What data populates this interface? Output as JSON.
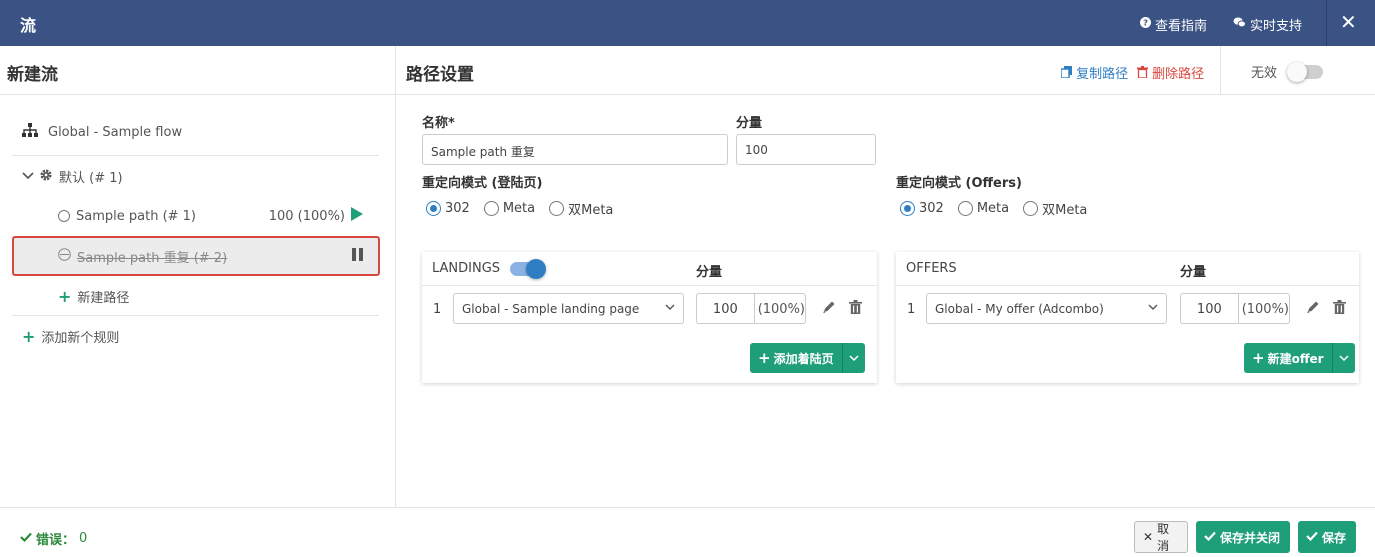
{
  "header": {
    "title": "流",
    "guide_label": "查看指南",
    "support_label": "实时支持",
    "close_label": "✕"
  },
  "left": {
    "title": "新建流",
    "flow_name": "Global - Sample flow",
    "rule_name": "默认 (# 1)",
    "paths": [
      {
        "label": "Sample path (# 1)",
        "share": "100 (100%)",
        "status": "active"
      },
      {
        "label": "Sample path 重复 (# 2)",
        "status": "paused"
      }
    ],
    "new_path_label": "新建路径",
    "add_rule_label": "添加新个规则"
  },
  "path_settings": {
    "title": "路径设置",
    "copy_label": "复制路径",
    "delete_label": "删除路径",
    "invalid_label": "无效",
    "name_label": "名称*",
    "name_value": "Sample path 重复",
    "share_label": "分量",
    "share_value": "100",
    "redirect_landing_label": "重定向模式 (登陆页)",
    "redirect_offers_label": "重定向模式 (Offers)",
    "redirect_options": [
      "302",
      "Meta",
      "双Meta"
    ],
    "landing_selected": "302",
    "offers_selected": "302"
  },
  "landings": {
    "title": "LANDINGS",
    "share_header": "分量",
    "rows": [
      {
        "index": "1",
        "name": "Global - Sample landing page",
        "share": "100",
        "percent": "(100%)"
      }
    ],
    "add_label": "添加着陆页"
  },
  "offers": {
    "title": "OFFERS",
    "share_header": "分量",
    "rows": [
      {
        "index": "1",
        "name": "Global - My offer (Adcombo)",
        "share": "100",
        "percent": "(100%)"
      }
    ],
    "add_label": "新建offer"
  },
  "footer": {
    "errors_label": "错误：",
    "errors_count": "0",
    "cancel_label": "取消",
    "save_close_label": "保存并关闭",
    "save_label": "保存"
  },
  "colors": {
    "header_bg": "#3a5284",
    "accent_green": "#1f9e7a",
    "accent_blue": "#2f7ec4",
    "danger_red": "#d9473f"
  }
}
